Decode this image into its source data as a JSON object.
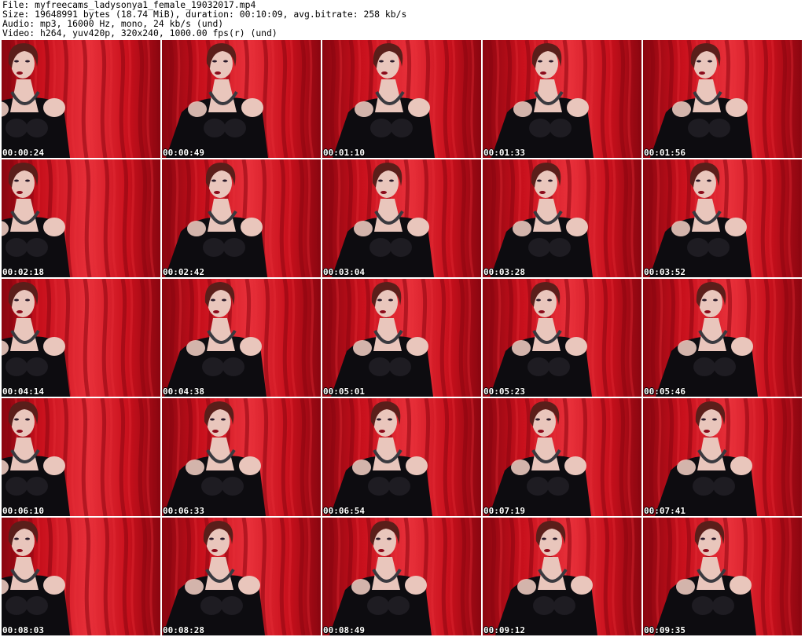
{
  "header": {
    "lines": [
      "File: myfreecams_ladysonya1_female_19032017.mp4",
      "Size: 19648991 bytes (18.74 MiB), duration: 00:10:09, avg.bitrate: 258 kb/s",
      "Audio: mp3, 16000 Hz, mono, 24 kb/s (und)",
      "Video: h264, yuv420p, 320x240, 1000.00 fps(r) (und)"
    ]
  },
  "grid": {
    "rows": 5,
    "cols": 5,
    "colors": {
      "curtain": "#c8101c",
      "curtain_dark": "#8a0610",
      "curtain_light": "#e8303a",
      "dress": "#0d0c10",
      "skin": "#e9c6bc",
      "hair": "#5a1e1a"
    },
    "timestamps": [
      "00:00:24",
      "00:00:49",
      "00:01:10",
      "00:01:33",
      "00:01:56",
      "00:02:18",
      "00:02:42",
      "00:03:04",
      "00:03:28",
      "00:03:52",
      "00:04:14",
      "00:04:38",
      "00:05:01",
      "00:05:23",
      "00:05:46",
      "00:06:10",
      "00:06:33",
      "00:06:54",
      "00:07:19",
      "00:07:41",
      "00:08:03",
      "00:08:28",
      "00:08:49",
      "00:09:12",
      "00:09:35"
    ]
  }
}
